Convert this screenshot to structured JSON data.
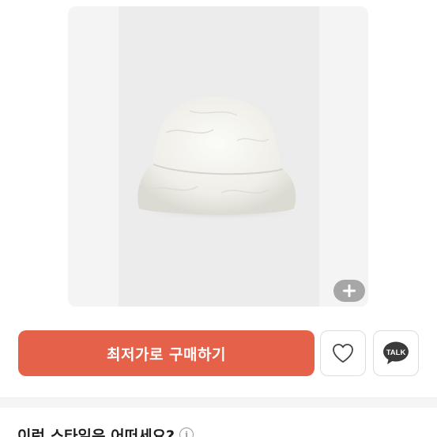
{
  "product": {
    "image_alt": "white faux fur bucket hat",
    "zoom_icon": "plus-icon"
  },
  "actions": {
    "buy_label": "최저가로 구매하기",
    "wish_icon": "heart-icon",
    "share_icon": "kakao-talk-icon",
    "share_label": "TALK"
  },
  "section": {
    "title": "이런 스타일은 어떠세요?",
    "info_icon": "info-icon",
    "info_glyph": "i"
  },
  "colors": {
    "accent": "#e6614a",
    "zoom_button": "#a7a7a7",
    "kakao_bubble": "#3a3a3a"
  }
}
